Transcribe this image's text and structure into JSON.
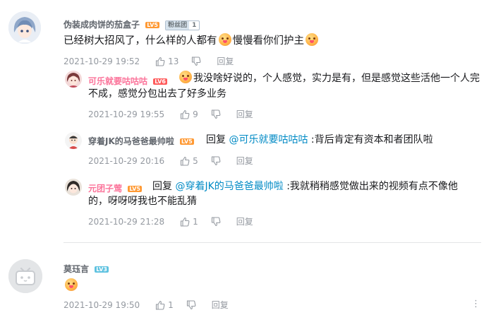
{
  "comments": [
    {
      "user": "伪装成肉饼的茄盒子",
      "level": "LV5",
      "fan_badge": {
        "name": "粉丝团",
        "level": "1"
      },
      "text_a": "已经树大招风了，什么样的人都有",
      "text_b": "慢慢看你们护主",
      "time": "2021-10-29 19:52",
      "likes": "13",
      "reply_label": "回复",
      "replies": [
        {
          "user": "可乐就要咕咕咕",
          "level": "LV6",
          "text_line1": "我没啥好说的，个人感觉，实力是有，但是感觉这些活他一个人完",
          "text_line2": "不成，感觉分包出去了好多业务",
          "time": "2021-10-29 19:55",
          "likes": "9",
          "reply_label": "回复"
        },
        {
          "user": "穿着JK的马爸爸最帅啦",
          "level": "LV5",
          "reply_prefix": "回复",
          "mention": "@可乐就要咕咕咕",
          "text": ":背后肯定有资本和者团队啦",
          "time": "2021-10-29 20:16",
          "likes": "5",
          "reply_label": "回复"
        },
        {
          "user": "元团子莺",
          "level": "LV5",
          "reply_prefix": "回复",
          "mention": "@穿着JK的马爸爸最帅啦",
          "text_line1": ":我就稍稍感觉做出来的视频有点不像他",
          "text_line2": "的，呀呀呀我也不能乱猜",
          "time": "2021-10-29 21:28",
          "likes": "1",
          "reply_label": "回复"
        }
      ]
    },
    {
      "user": "莫珏言",
      "level": "LV3",
      "time": "2021-10-29 19:50",
      "likes": "1",
      "reply_label": "回复",
      "more": "⋮"
    }
  ],
  "colors": {
    "pink": "#fb7299",
    "link": "#008ac5",
    "meta": "#9499a0"
  },
  "icons": [
    "thumb-up-icon",
    "thumb-down-icon",
    "emoji-icon",
    "more-icon",
    "tv-avatar-icon"
  ]
}
